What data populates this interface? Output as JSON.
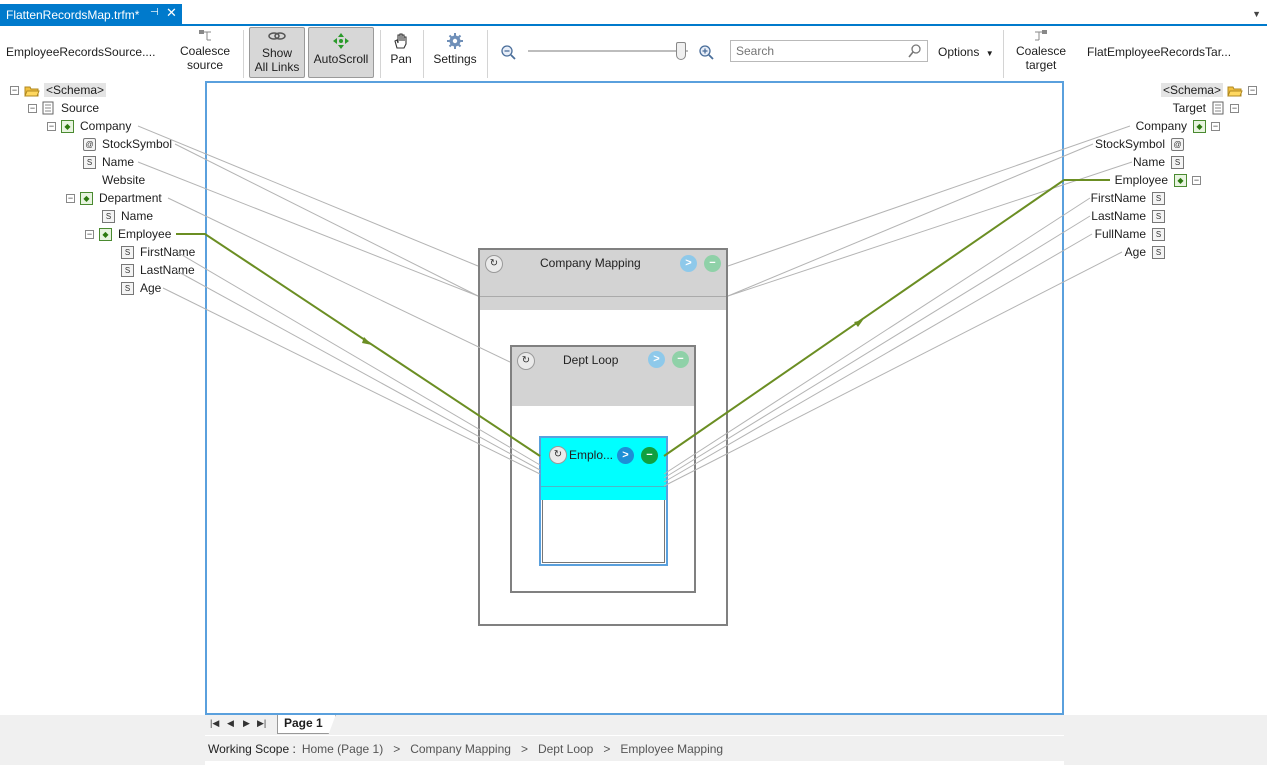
{
  "tab": {
    "title": "FlattenRecordsMap.trfm*",
    "pin": "⊣",
    "close": "✕"
  },
  "toolbar": {
    "source_name": "EmployeeRecordsSource....",
    "coalesce_source": [
      "Coalesce",
      "source"
    ],
    "show_all_links": [
      "Show",
      "All Links"
    ],
    "autoscroll": "AutoScroll",
    "pan": "Pan",
    "settings": "Settings",
    "search_placeholder": "Search",
    "options": "Options",
    "coalesce_target": [
      "Coalesce",
      "target"
    ],
    "target_name": "FlatEmployeeRecordsTar..."
  },
  "source_tree": {
    "schema": "<Schema>",
    "root": "Source",
    "items": [
      "Company",
      "StockSymbol",
      "Name",
      "Website",
      "Department",
      "Name",
      "Employee",
      "FirstName",
      "LastName",
      "Age"
    ]
  },
  "target_tree": {
    "schema": "<Schema>",
    "root": "Target",
    "items": [
      "Company",
      "StockSymbol",
      "Name",
      "Employee",
      "FirstName",
      "LastName",
      "FullName",
      "Age"
    ]
  },
  "functoids": {
    "company": "Company Mapping",
    "dept": "Dept Loop",
    "employee": "Emplo..."
  },
  "pages": {
    "current": "Page 1"
  },
  "scope": {
    "label": "Working Scope :",
    "crumbs": [
      "Home (Page 1)",
      "Company Mapping",
      "Dept Loop",
      "Employee Mapping"
    ],
    "separator": ">"
  },
  "colors": {
    "accent": "#007acc",
    "active_link": "#6b8e23",
    "inactive_link": "#b4b4b4",
    "selected_functoid": "#00ffff"
  }
}
